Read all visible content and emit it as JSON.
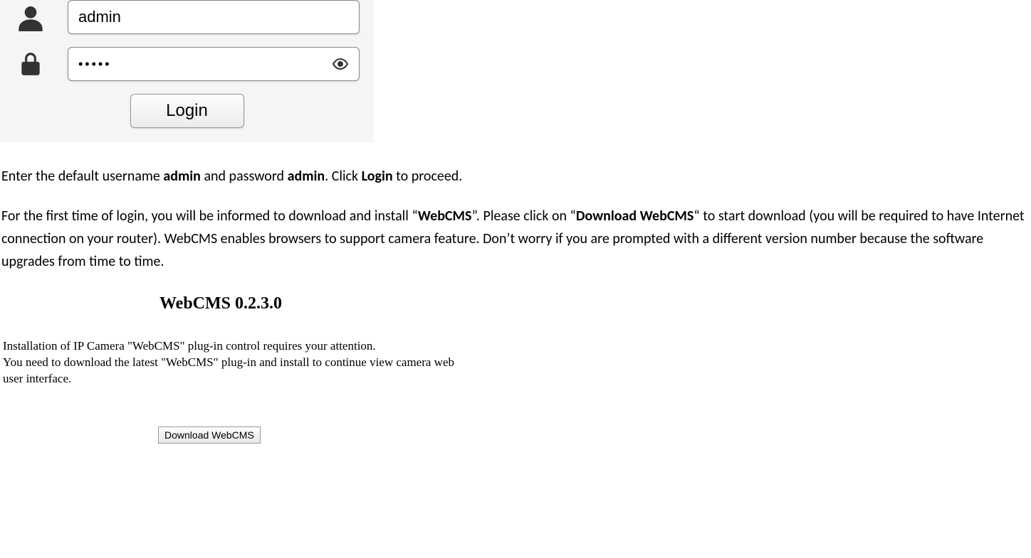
{
  "login": {
    "username_value": "admin",
    "password_masked": "•••••",
    "login_button": "Login"
  },
  "doc": {
    "p1_a": "Enter the default username ",
    "p1_b": "admin",
    "p1_c": " and password ",
    "p1_d": "admin",
    "p1_e": ". Click ",
    "p1_f": "Login",
    "p1_g": " to proceed.",
    "p2_a": "For the first time of login, you will be informed to download and install “",
    "p2_b": "WebCMS",
    "p2_c": "”. Please click on “",
    "p2_d": "Download WebCMS",
    "p2_e": "“ to start download (you will be required to have Internet connection on your router). WebCMS enables browsers to support camera feature. Don’t worry if you are prompted with a different version number because the software upgrades from time to time."
  },
  "webcms": {
    "title": "WebCMS 0.2.3.0",
    "desc_line1": "Installation of IP Camera \"WebCMS\" plug-in control requires your attention.",
    "desc_line2": "You need to download the latest \"WebCMS\" plug-in and install to continue view camera web user interface.",
    "download_button": "Download WebCMS"
  }
}
